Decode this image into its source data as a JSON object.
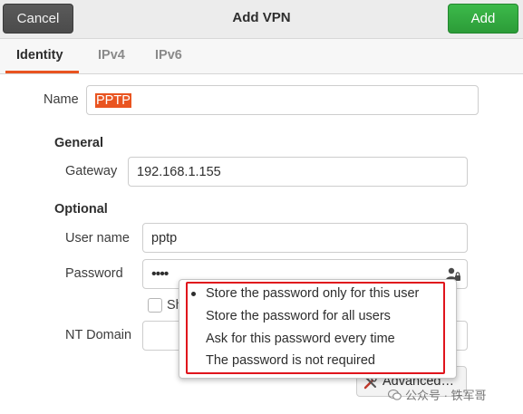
{
  "header": {
    "cancel_label": "Cancel",
    "title": "Add VPN",
    "add_label": "Add"
  },
  "tabs": [
    {
      "label": "Identity",
      "active": true
    },
    {
      "label": "IPv4",
      "active": false
    },
    {
      "label": "IPv6",
      "active": false
    }
  ],
  "identity": {
    "name_label": "Name",
    "name_value": "PPTP"
  },
  "general": {
    "section_label": "General",
    "gateway_label": "Gateway",
    "gateway_value": "192.168.1.155"
  },
  "optional": {
    "section_label": "Optional",
    "username_label": "User name",
    "username_value": "pptp",
    "password_label": "Password",
    "password_value": "••••",
    "show_password_label": "Sh",
    "nt_domain_label": "NT Domain",
    "nt_domain_value": ""
  },
  "password_menu": {
    "items": [
      {
        "label": "Store the password only for this user",
        "selected": true
      },
      {
        "label": "Store the password for all users",
        "selected": false
      },
      {
        "label": "Ask for this password every time",
        "selected": false
      },
      {
        "label": "The password is not required",
        "selected": false
      }
    ]
  },
  "advanced_button_label": "Advanced…",
  "watermark": "公众号 · 铁军哥",
  "colors": {
    "accent": "#e95420",
    "add_button": "#33a840",
    "highlight_box": "#e0141c"
  }
}
